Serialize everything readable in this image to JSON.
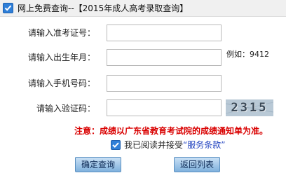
{
  "header": {
    "title": "网上免费查询--【2015年成人高考录取查询】"
  },
  "form": {
    "exam_number_label": "请输入准考证号：",
    "exam_number_value": "",
    "birth_label": "请输入出生年月：",
    "birth_value": "",
    "birth_hint": "例如：9412",
    "phone_label": "请输入手机号码：",
    "phone_value": "",
    "captcha_label": "请输入验证码：",
    "captcha_value": "",
    "captcha_image_text": "2315"
  },
  "notice": "注意：成绩以广东省教育考试院的成绩通知单为准。",
  "agreement": {
    "prefix": "我已阅读并接受",
    "link_text": "“服务条款”",
    "checked": true
  },
  "buttons": {
    "query_label": "确定查询",
    "back_label": "返回列表"
  },
  "colors": {
    "accent": "#2f7fd8",
    "notice": "#d90000",
    "link": "#1d3fbf"
  }
}
